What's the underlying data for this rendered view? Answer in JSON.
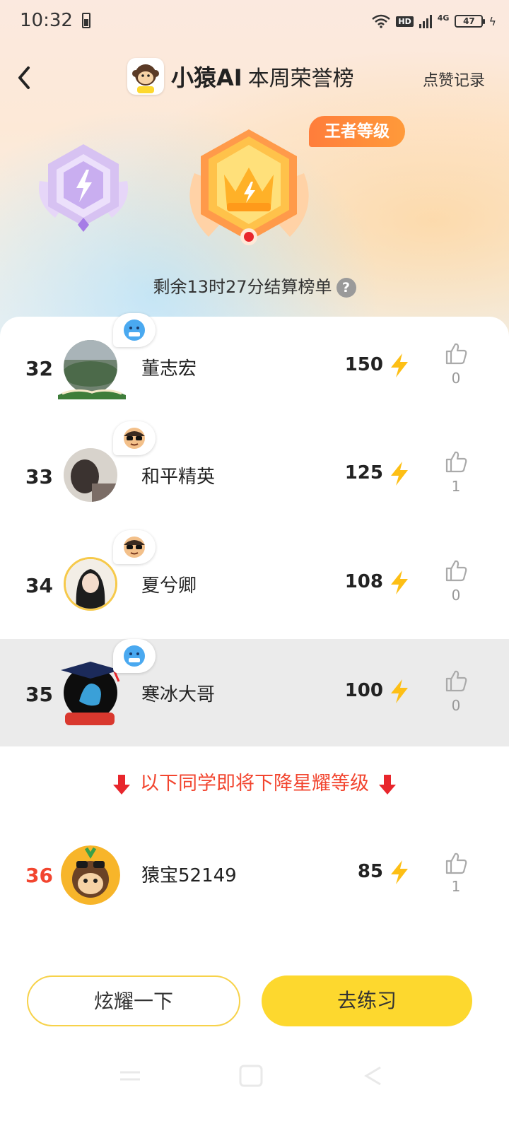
{
  "status_bar": {
    "time": "10:32",
    "hd": "HD",
    "network": "4G",
    "battery": "47"
  },
  "header": {
    "title": "小猿AI",
    "subtitle": "本周荣誉榜",
    "likes_record": "点赞记录"
  },
  "hero": {
    "level_tag": "王者等级",
    "countdown": "剩余13时27分结算榜单",
    "help_icon": "?"
  },
  "rows": [
    {
      "rank": "32",
      "name": "董志宏",
      "score": "150",
      "likes": "0",
      "bubble_icon": "cold-face-icon"
    },
    {
      "rank": "33",
      "name": "和平精英",
      "score": "125",
      "likes": "1",
      "bubble_icon": "sunglasses-face-icon"
    },
    {
      "rank": "34",
      "name": "夏兮卿",
      "score": "108",
      "likes": "0",
      "bubble_icon": "sunglasses-face-icon"
    },
    {
      "rank": "35",
      "name": "寒冰大哥",
      "score": "100",
      "likes": "0",
      "bubble_icon": "cold-face-icon",
      "highlighted": true
    },
    {
      "rank": "36",
      "name": "猿宝52149",
      "score": "85",
      "likes": "1"
    }
  ],
  "warning": "以下同学即将下降星耀等级",
  "buttons": {
    "show_off": "炫耀一下",
    "practice": "去练习"
  },
  "colors": {
    "accent_yellow": "#fdd82e",
    "warning_red": "#f2452f",
    "level_orange": "#ff8a3a"
  }
}
